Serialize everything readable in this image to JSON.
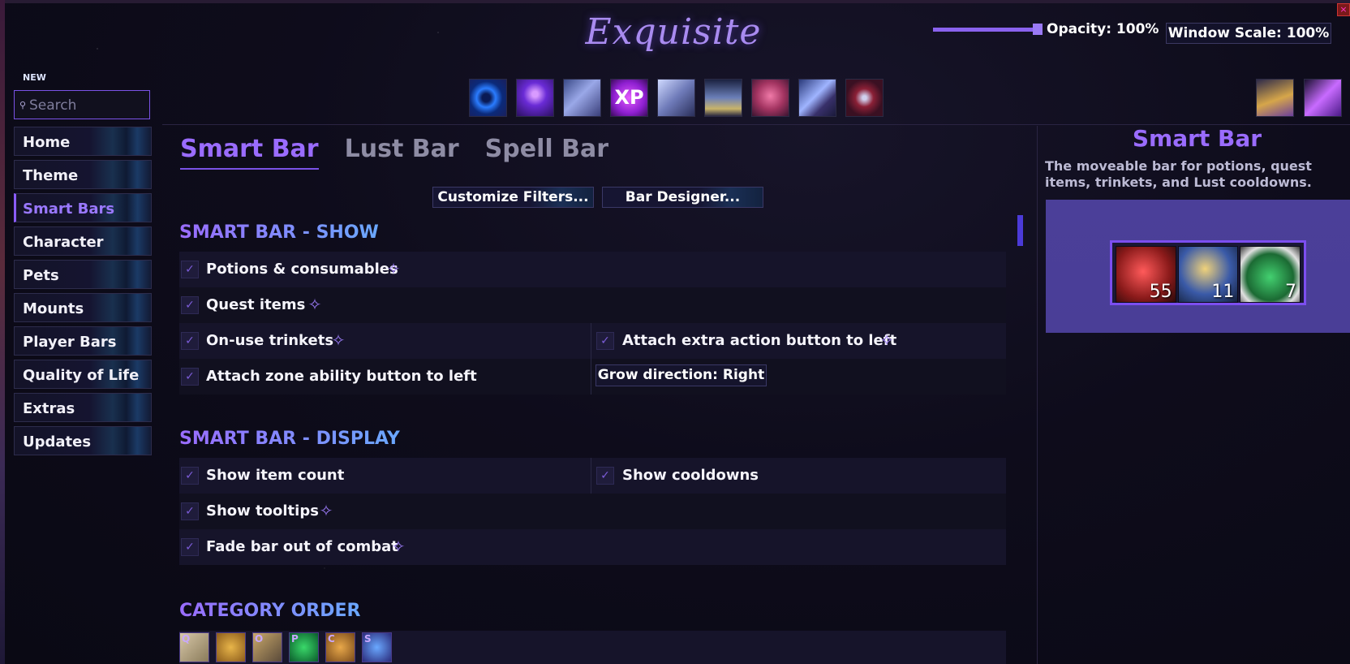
{
  "app": {
    "title": "Exquisite"
  },
  "header": {
    "opacity_label": "Opacity: 100%",
    "opacity_value": 1.0,
    "window_scale_label": "Window Scale: 100%",
    "close_glyph": "×"
  },
  "search": {
    "badge": "NEW",
    "placeholder": "Search",
    "value": "",
    "icon": "search-icon"
  },
  "top_icons": [
    {
      "name": "swirl-portal-icon"
    },
    {
      "name": "character-aura-icon"
    },
    {
      "name": "armor-upgrade-icon"
    },
    {
      "name": "xp-icon",
      "text": "XP"
    },
    {
      "name": "crystal-armor-icon"
    },
    {
      "name": "temple-pillar-icon"
    },
    {
      "name": "creature-portrait-icon"
    },
    {
      "name": "dragon-mount-icon"
    },
    {
      "name": "shield-crest-icon"
    }
  ],
  "top_right_icons": [
    {
      "name": "treasure-chest-icon"
    },
    {
      "name": "crystal-sword-icon"
    }
  ],
  "sidebar": {
    "items": [
      {
        "label": "Home",
        "active": false
      },
      {
        "label": "Theme",
        "active": false
      },
      {
        "label": "Smart Bars",
        "active": true
      },
      {
        "label": "Character",
        "active": false
      },
      {
        "label": "Pets",
        "active": false
      },
      {
        "label": "Mounts",
        "active": false
      },
      {
        "label": "Player Bars",
        "active": false
      },
      {
        "label": "Quality of Life",
        "active": false
      },
      {
        "label": "Extras",
        "active": false
      },
      {
        "label": "Updates",
        "active": false
      }
    ]
  },
  "tabs": [
    {
      "label": "Smart Bar",
      "active": true
    },
    {
      "label": "Lust Bar",
      "active": false
    },
    {
      "label": "Spell Bar",
      "active": false
    }
  ],
  "buttons": {
    "customize_filters": "Customize Filters...",
    "bar_designer": "Bar Designer..."
  },
  "show_section": {
    "title": "SMART BAR - SHOW",
    "options": [
      {
        "label": "Potions & consumables",
        "checked": true,
        "sparkle": true
      },
      {
        "label": "Quest items",
        "checked": true,
        "sparkle": true
      },
      {
        "label": "On-use trinkets",
        "checked": true,
        "sparkle": true
      },
      {
        "label": "Attach extra action button to left",
        "checked": true,
        "sparkle": true
      },
      {
        "label": "Attach zone ability button to left",
        "checked": true,
        "sparkle": false
      }
    ],
    "grow_direction": "Grow direction: Right"
  },
  "display_section": {
    "title": "SMART BAR - DISPLAY",
    "options": [
      {
        "label": "Show item count",
        "checked": true,
        "sparkle": false
      },
      {
        "label": "Show cooldowns",
        "checked": true,
        "sparkle": false
      },
      {
        "label": "Show tooltips",
        "checked": true,
        "sparkle": true
      },
      {
        "label": "Fade bar out of combat",
        "checked": true,
        "sparkle": true
      }
    ]
  },
  "category_order": {
    "title": "CATEGORY ORDER",
    "items": [
      {
        "letter": "Q",
        "name": "quest-scroll-icon"
      },
      {
        "letter": "",
        "name": "gold-pouch-icon"
      },
      {
        "letter": "O",
        "name": "trinket-chest-icon"
      },
      {
        "letter": "P",
        "name": "potion-green-icon"
      },
      {
        "letter": "C",
        "name": "consumable-bag-icon"
      },
      {
        "letter": "S",
        "name": "special-orb-icon"
      }
    ]
  },
  "right_panel": {
    "title": "Smart Bar",
    "description": "The moveable bar for potions, quest items, trinkets, and Lust cooldowns.",
    "preview_items": [
      {
        "name": "red-potion-icon",
        "count": "55"
      },
      {
        "name": "gold-flask-icon",
        "count": "11"
      },
      {
        "name": "green-tome-icon",
        "count": "7"
      }
    ]
  },
  "icons": {
    "checkbox": "✓",
    "sparkle": "✧"
  }
}
